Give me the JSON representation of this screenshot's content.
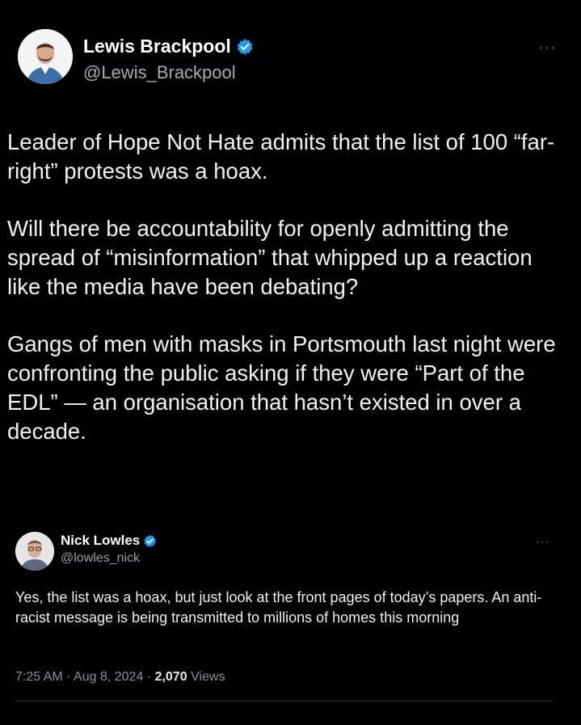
{
  "author": {
    "name": "Lewis Brackpool",
    "handle": "@Lewis_Brackpool",
    "verified": true,
    "avatar_icon": "profile-photo-icon"
  },
  "more_menu": "···",
  "tweet": {
    "paragraphs": [
      "Leader of Hope Not Hate admits that the list of 100 “far-right” protests was a hoax.",
      "Will there be accountability for openly admitting the spread of “misinformation” that whipped up a reaction like the media have been debating?",
      "Gangs of men with masks in Portsmouth last night were confronting the public asking if they were “Part of the EDL” — an organisation that hasn’t existed in over a decade."
    ]
  },
  "quoted": {
    "name": "Nick Lowles",
    "handle": "@lowles_nick",
    "verified": true,
    "text": "Yes, the list was a hoax, but just look at the front pages of today’s papers. An anti-racist message is being transmitted to millions of homes this morning",
    "time": "7:25 AM · Aug 8, 2024 ·",
    "views_count": "2,070",
    "views_label": "Views"
  },
  "colors": {
    "background": "#000000",
    "verified_badge": "#1d9bf0",
    "secondary_text": "#a8acb0"
  }
}
